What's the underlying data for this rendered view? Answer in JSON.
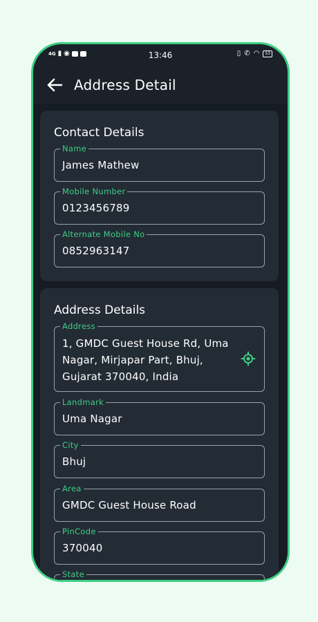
{
  "status": {
    "network": "4G",
    "time": "13:46",
    "battery": "53"
  },
  "header": {
    "title": "Address Detail"
  },
  "contact": {
    "title": "Contact Details",
    "name": {
      "label": "Name",
      "value": "James Mathew"
    },
    "mobile": {
      "label": "Mobile Number",
      "value": "0123456789"
    },
    "alternate": {
      "label": "Alternate Mobile No",
      "value": "0852963147"
    }
  },
  "address": {
    "title": "Address Details",
    "address": {
      "label": "Address",
      "value": "1, GMDC Guest House Rd, Uma Nagar, Mirjapar Part, Bhuj, Gujarat 370040, India"
    },
    "landmark": {
      "label": "Landmark",
      "value": "Uma Nagar"
    },
    "city": {
      "label": "City",
      "value": "Bhuj"
    },
    "area": {
      "label": "Area",
      "value": "GMDC Guest House Road"
    },
    "pincode": {
      "label": "PinCode",
      "value": "370040"
    },
    "state": {
      "label": "State",
      "value": ""
    }
  },
  "colors": {
    "accent": "#3ecf83",
    "background": "#1b2129",
    "card": "#232b35",
    "frame_bg": "#edfcf3"
  },
  "icons": {
    "back": "arrow-left-icon",
    "location": "my-location-icon"
  }
}
